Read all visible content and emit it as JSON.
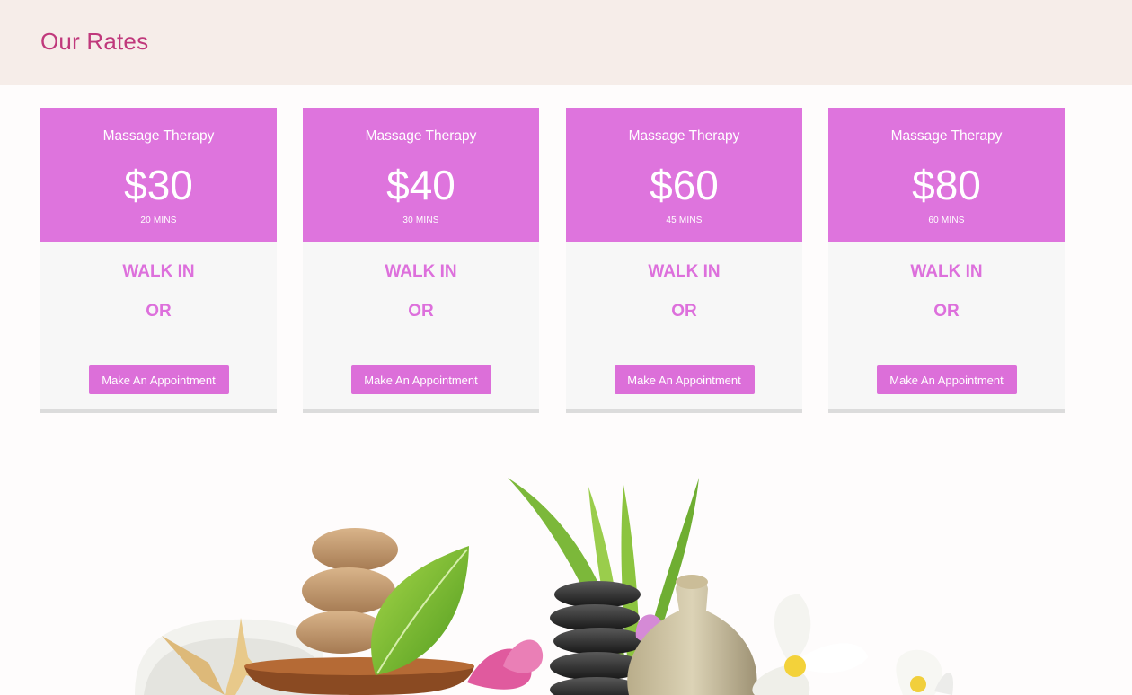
{
  "header": {
    "title": "Our Rates"
  },
  "rates": [
    {
      "service": "Massage Therapy",
      "price": "$30",
      "duration": "20 MINS",
      "walk_in": "WALK IN",
      "or": "OR",
      "button": "Make An Appointment"
    },
    {
      "service": "Massage Therapy",
      "price": "$40",
      "duration": "30 MINS",
      "walk_in": "WALK IN",
      "or": "OR",
      "button": "Make An Appointment"
    },
    {
      "service": "Massage Therapy",
      "price": "$60",
      "duration": "45 MINS",
      "walk_in": "WALK IN",
      "or": "OR",
      "button": "Make An Appointment"
    },
    {
      "service": "Massage Therapy",
      "price": "$80",
      "duration": "60 MINS",
      "walk_in": "WALK IN",
      "or": "OR",
      "button": "Make An Appointment"
    }
  ],
  "colors": {
    "header_bg": "#f6ede9",
    "title": "#c0397c",
    "card_head": "#de74dd",
    "accent": "#dd70dc",
    "card_body": "#f7f7f7"
  }
}
